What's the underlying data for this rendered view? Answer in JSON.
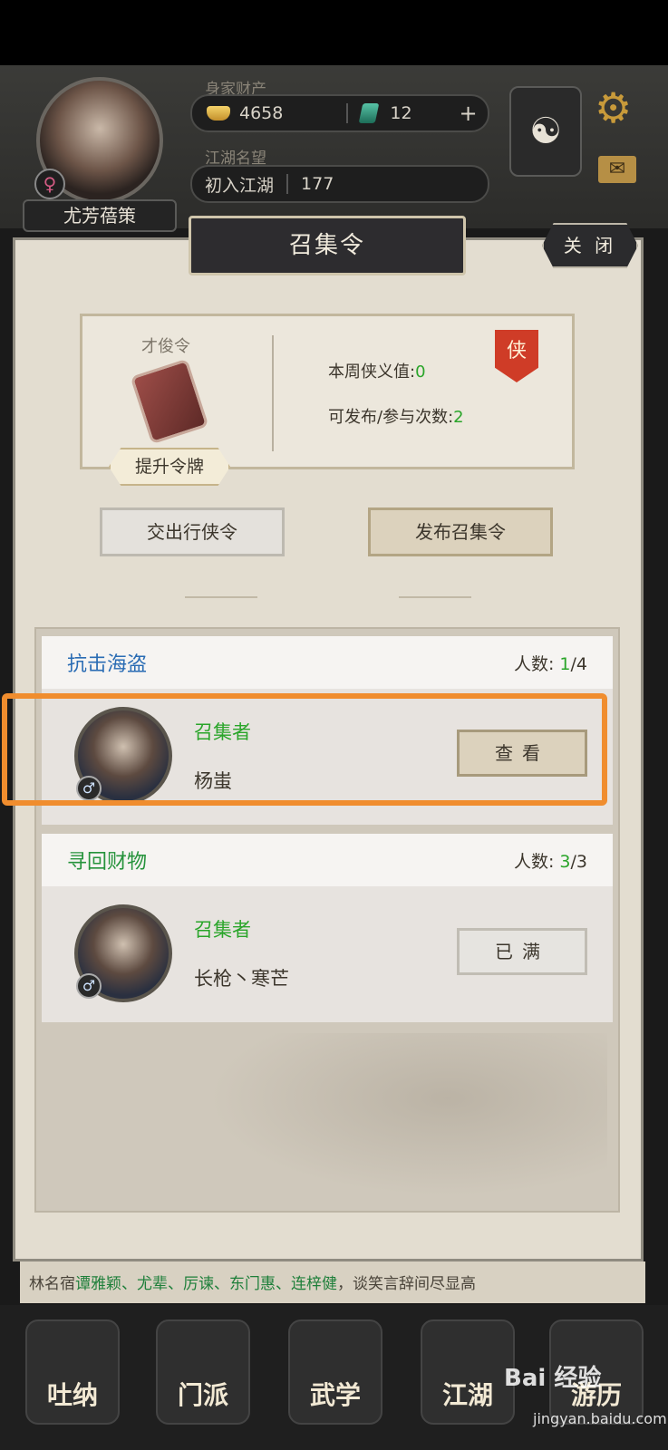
{
  "header": {
    "assets_label": "身家财产",
    "gold_amount": "4658",
    "jade_amount": "12",
    "add_symbol": "+",
    "reputation_label": "江湖名望",
    "reputation_rank": "初入江湖",
    "reputation_value": "177",
    "player_name": "尤芳蓓策",
    "gender_symbol": "♀"
  },
  "dialog": {
    "title": "召集令",
    "close_label": "关 闭"
  },
  "token": {
    "name": "才俊令",
    "upgrade_label": "提升令牌",
    "weekly_label": "本周侠义值:",
    "weekly_value": "0",
    "publish_label": "可发布/参与次数:",
    "publish_value": "2",
    "badge": "侠"
  },
  "actions": {
    "submit_label": "交出行侠令",
    "publish_label": "发布召集令"
  },
  "missions": [
    {
      "title": "抗击海盗",
      "count_label": "人数:",
      "count_current": "1",
      "count_total": "/4",
      "convener_label": "召集者",
      "convener_name": "杨蚩",
      "gender_symbol": "♂",
      "button_label": "查看"
    },
    {
      "title": "寻回财物",
      "count_label": "人数:",
      "count_current": "3",
      "count_total": "/3",
      "convener_label": "召集者",
      "convener_name": "长枪丶寒芒",
      "gender_symbol": "♂",
      "button_label": "已满"
    }
  ],
  "story": {
    "prefix": "林名宿",
    "names": "谭雅颖、尤辈、厉谏、东门惠、连梓健",
    "suffix": "，谈笑言辞间尽显高"
  },
  "nav": [
    {
      "label": "吐纳"
    },
    {
      "label": "门派"
    },
    {
      "label": "武学"
    },
    {
      "label": "江湖"
    },
    {
      "label": "游历"
    }
  ],
  "watermark": {
    "text": "Bai 经验",
    "url": "jingyan.baidu.com"
  },
  "colors": {
    "highlight": "#f08d2e",
    "green_value": "#2aa52a",
    "blue_title": "#2a6cb4",
    "green_title": "#26933c"
  }
}
